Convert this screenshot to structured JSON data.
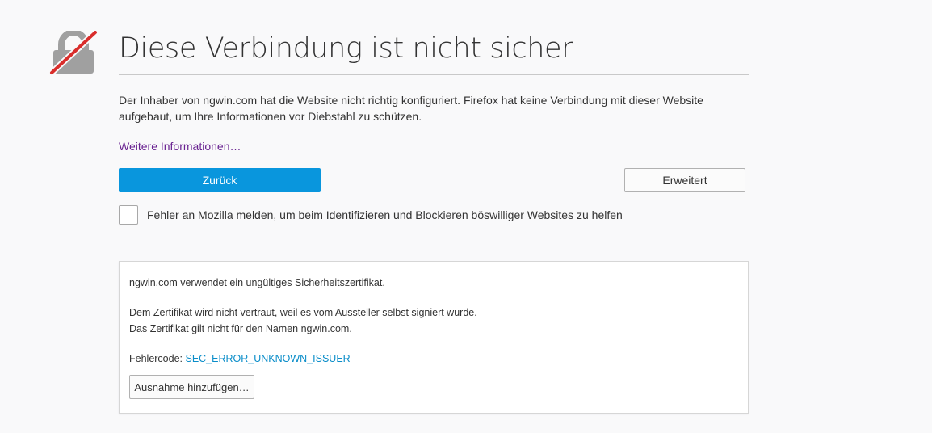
{
  "page": {
    "title": "Diese Verbindung ist nicht sicher",
    "description": "Der Inhaber von ngwin.com hat die Website nicht richtig konfiguriert. Firefox hat keine Verbindung mit dieser Website aufgebaut, um Ihre Informationen vor Diebstahl zu schützen.",
    "learn_more": "Weitere Informationen…"
  },
  "buttons": {
    "back_label": "Zurück",
    "advanced_label": "Erweitert"
  },
  "report": {
    "checked": false,
    "label": "Fehler an Mozilla melden, um beim Identifizieren und Blockieren böswilliger Websites zu helfen"
  },
  "advanced": {
    "line1": "ngwin.com verwendet ein ungültiges Sicherheitszertifikat.",
    "line2": "Dem Zertifikat wird nicht vertraut, weil es vom Aussteller selbst signiert wurde.",
    "line3": "Das Zertifikat gilt nicht für den Namen ngwin.com.",
    "error_code_prefix": "Fehlercode: ",
    "error_code": "SEC_ERROR_UNKNOWN_ISSUER",
    "exception_button": "Ausnahme hinzufügen…"
  },
  "icons": {
    "lock": "broken-lock-icon"
  },
  "colors": {
    "background": "#f9f9fa",
    "primary_button": "#0996dd",
    "learn_more_link": "#6a2391",
    "error_code_link": "#0a8dc9",
    "lock_gray": "#a0a0a0",
    "strike_red": "#d92d2b"
  }
}
